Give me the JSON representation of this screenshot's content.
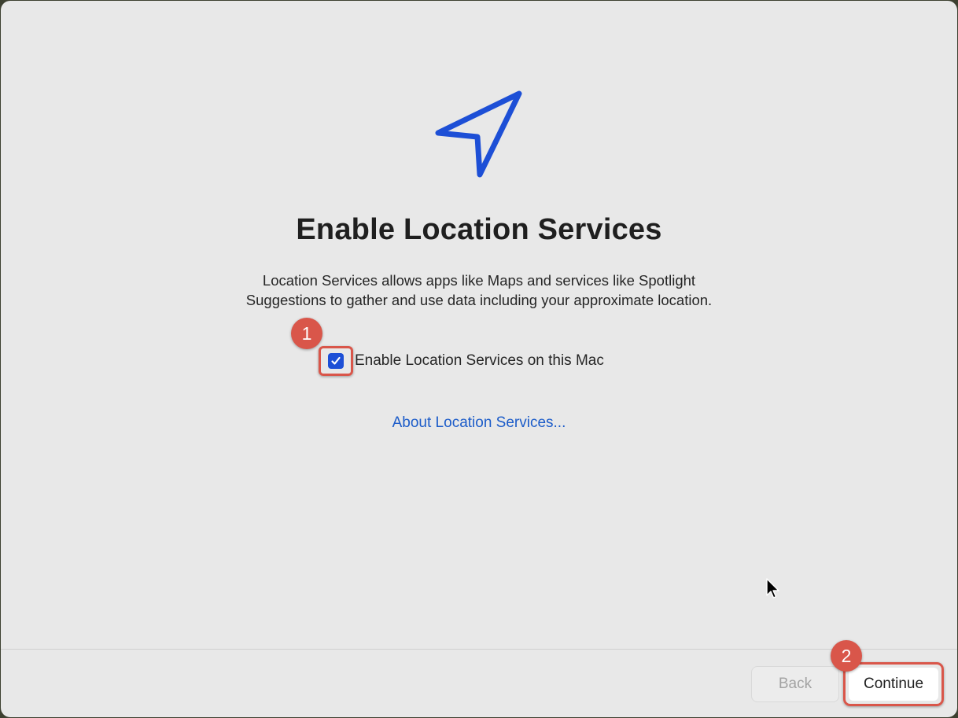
{
  "setup": {
    "title": "Enable Location Services",
    "description_line1": "Location Services allows apps like Maps and services like Spotlight",
    "description_line2": "Suggestions to gather and use data including your approximate location.",
    "checkbox_label": "Enable Location Services on this Mac",
    "checkbox_checked": true,
    "about_link": "About Location Services..."
  },
  "footer": {
    "back_label": "Back",
    "continue_label": "Continue"
  },
  "annotations": {
    "step1": "1",
    "step2": "2"
  },
  "colors": {
    "accent": "#1d4fd6",
    "link": "#1c5cc9",
    "annotation": "#d9564a",
    "background": "#e8e8e8"
  },
  "icons": {
    "hero": "location-arrow-icon",
    "checkbox": "checkmark-icon",
    "pointer": "mouse-cursor-icon"
  }
}
